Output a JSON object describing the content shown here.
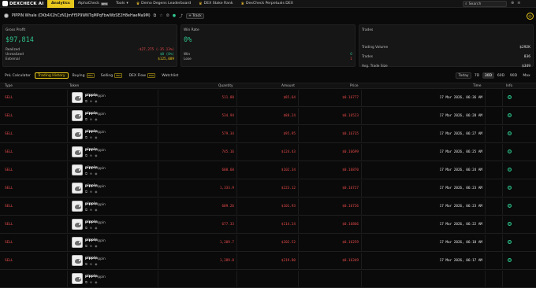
{
  "nav": {
    "logo": "DEXCHECK AI",
    "items": [
      {
        "label": "Analytics",
        "active": true
      },
      {
        "label": "AlphaCheck",
        "badge": "NEW"
      },
      {
        "label": "Tools",
        "dropdown": true
      },
      {
        "label": "Demo Degens Leaderboard",
        "icon": "crown-icon"
      },
      {
        "label": "DEX Stake Rank",
        "icon": "crown-icon"
      },
      {
        "label": "DexCheck Perpetuals DEX",
        "icon": "crown-icon"
      }
    ],
    "search_placeholder": "Search"
  },
  "wallet": {
    "title": "PIPPIN Whale (DKb4X2hCzN1JmFf5P9WNTqMPqFbwWbSE2H8eHaeMa9M)",
    "track_label": "Track"
  },
  "gross_profit": {
    "title": "Gross Profit",
    "value": "$97,814",
    "realized_label": "Realized",
    "realized_value": "-$27,275 (-35.13%)",
    "unrealized_label": "Unrealized",
    "unrealized_value": "$0 (0%)",
    "external_label": "External",
    "external_value": "$125,089"
  },
  "win_rate": {
    "title": "Win Rate",
    "value": "0%",
    "win_label": "Win",
    "win_value": "0",
    "lose_label": "Lose",
    "lose_value": "1"
  },
  "trades": {
    "title": "Trades",
    "volume_label": "Trading Volume",
    "volume_value": "$292K",
    "trades_label": "Trades",
    "trades_value": "836",
    "avg_label": "Avg. Trade Size",
    "avg_value": "$349"
  },
  "tabs": [
    {
      "label": "PnL Calculator"
    },
    {
      "label": "Trading History",
      "active": true
    },
    {
      "label": "Buying",
      "pro": "PRO"
    },
    {
      "label": "Selling",
      "pro": "PRO"
    },
    {
      "label": "DEX Flow",
      "pro": "PRO"
    },
    {
      "label": "Watchlist"
    }
  ],
  "periods": [
    "Today",
    "7D",
    "30D",
    "60D",
    "90D",
    "Max"
  ],
  "active_period": "30D",
  "table": {
    "headers": {
      "type": "Type",
      "token": "Token",
      "quantity": "Quantity",
      "amount": "Amount",
      "price": "Price",
      "time": "Time",
      "info": "Info"
    },
    "rows": [
      {
        "type": "SELL",
        "token": "pippin",
        "symbol": "Pippin",
        "quantity": "511.88",
        "amount": "$85.64",
        "price": "$0.16777",
        "time": "17 Mar 2026, 06:36 AM"
      },
      {
        "type": "SELL",
        "token": "pippin",
        "symbol": "Pippin",
        "quantity": "534.94",
        "amount": "$88.24",
        "price": "$0.16523",
        "time": "17 Mar 2026, 06:28 AM"
      },
      {
        "type": "SELL",
        "token": "pippin",
        "symbol": "Pippin",
        "quantity": "579.34",
        "amount": "$95.95",
        "price": "$0.16735",
        "time": "17 Mar 2026, 06:27 AM"
      },
      {
        "type": "SELL",
        "token": "pippin",
        "symbol": "Pippin",
        "quantity": "745.16",
        "amount": "$124.43",
        "price": "$0.16699",
        "time": "17 Mar 2026, 06:25 AM"
      },
      {
        "type": "SELL",
        "token": "pippin",
        "symbol": "Pippin",
        "quantity": "608.60",
        "amount": "$102.34",
        "price": "$0.16870",
        "time": "17 Mar 2026, 06:24 AM"
      },
      {
        "type": "SELL",
        "token": "pippin",
        "symbol": "Pippin",
        "quantity": "1,333.9",
        "amount": "$223.12",
        "price": "$0.16727",
        "time": "17 Mar 2026, 06:23 AM"
      },
      {
        "type": "SELL",
        "token": "pippin",
        "symbol": "Pippin",
        "quantity": "609.26",
        "amount": "$101.93",
        "price": "$0.16726",
        "time": "17 Mar 2026, 06:23 AM"
      },
      {
        "type": "SELL",
        "token": "pippin",
        "symbol": "Pippin",
        "quantity": "677.33",
        "amount": "$114.24",
        "price": "$0.16866",
        "time": "17 Mar 2026, 06:22 AM"
      },
      {
        "type": "SELL",
        "token": "pippin",
        "symbol": "Pippin",
        "quantity": "1,209.7",
        "amount": "$202.52",
        "price": "$0.16259",
        "time": "17 Mar 2026, 06:18 AM"
      },
      {
        "type": "SELL",
        "token": "pippin",
        "symbol": "Pippin",
        "quantity": "1,289.8",
        "amount": "$219.80",
        "price": "$0.16349",
        "time": "17 Mar 2026, 06:17 AM"
      }
    ],
    "partial_row_token": "pippin",
    "partial_row_symbol": "Pippin"
  },
  "colors": {
    "accent": "#e9c81e",
    "positive": "#2fc48d",
    "negative": "#e84a4a"
  }
}
